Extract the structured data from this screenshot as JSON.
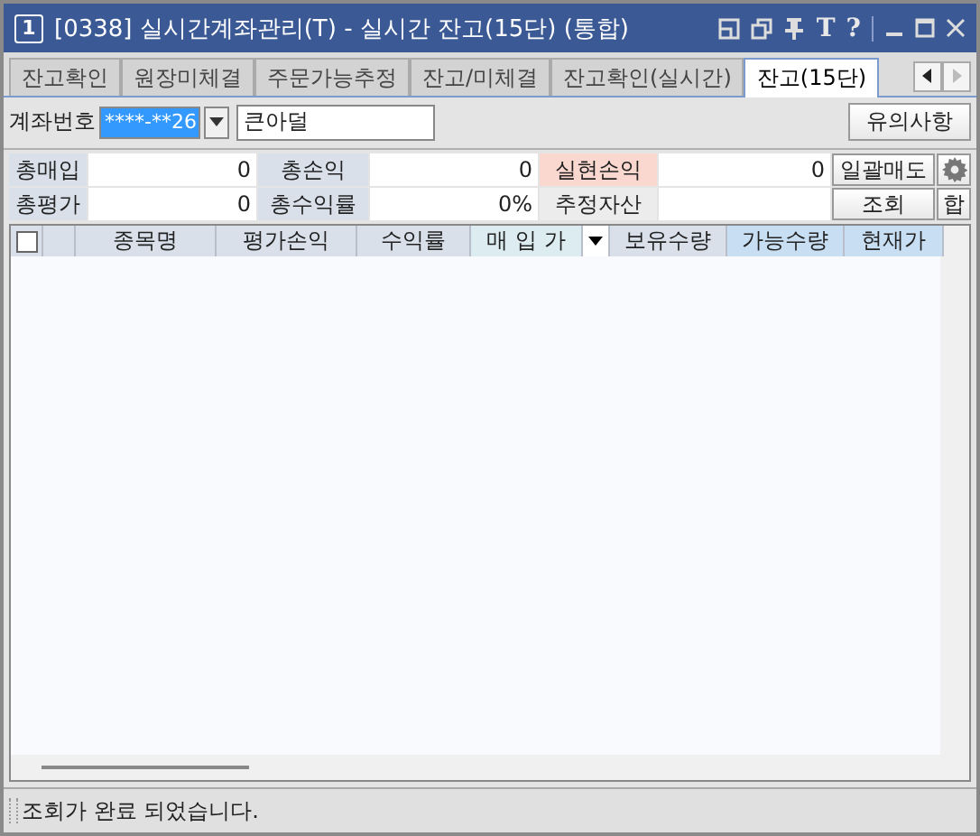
{
  "window": {
    "badge": "1",
    "title": "[0338] 실시간계좌관리(T) - 실시간 잔고(15단) (통합)",
    "font_button": "T",
    "help_button": "?"
  },
  "tabs": [
    {
      "label": "잔고확인",
      "selected": false
    },
    {
      "label": "원장미체결",
      "selected": false
    },
    {
      "label": "주문가능추정",
      "selected": false
    },
    {
      "label": "잔고/미체결",
      "selected": false
    },
    {
      "label": "잔고확인(실시간)",
      "selected": false
    },
    {
      "label": "잔고(15단)",
      "selected": true
    }
  ],
  "account": {
    "label": "계좌번호",
    "number": "****-**26",
    "name": "큰아덜",
    "notice_button": "유의사항"
  },
  "summary": [
    [
      {
        "kind": "label",
        "text": "총매입"
      },
      {
        "kind": "value",
        "text": "0"
      },
      {
        "kind": "label",
        "text": "총손익"
      },
      {
        "kind": "value",
        "text": "0"
      },
      {
        "kind": "alert",
        "text": "실현손익"
      },
      {
        "kind": "value",
        "text": "0"
      },
      {
        "kind": "button",
        "text": "일괄매도"
      },
      {
        "kind": "gear"
      }
    ],
    [
      {
        "kind": "label",
        "text": "총평가"
      },
      {
        "kind": "value",
        "text": "0"
      },
      {
        "kind": "label",
        "text": "총수익률"
      },
      {
        "kind": "value",
        "text": "0%"
      },
      {
        "kind": "plain",
        "text": "추정자산"
      },
      {
        "kind": "value"
      },
      {
        "kind": "button",
        "text": "조회"
      },
      {
        "kind": "button",
        "text": "합"
      }
    ]
  ],
  "table": {
    "select_all": {
      "checked": false
    },
    "columns": [
      {
        "label": "종목명",
        "highlighted": false
      },
      {
        "label": "평가손익",
        "highlighted": false
      },
      {
        "label": "수익률",
        "highlighted": false
      },
      {
        "label": "매 입 가",
        "highlighted": false,
        "dropdown": true
      },
      {
        "label": "보유수량",
        "highlighted": false
      },
      {
        "label": "가능수량",
        "highlighted": true
      },
      {
        "label": "현재가",
        "highlighted": true
      }
    ]
  },
  "status_bar": {
    "message": "조회가 완료 되었습니다."
  }
}
